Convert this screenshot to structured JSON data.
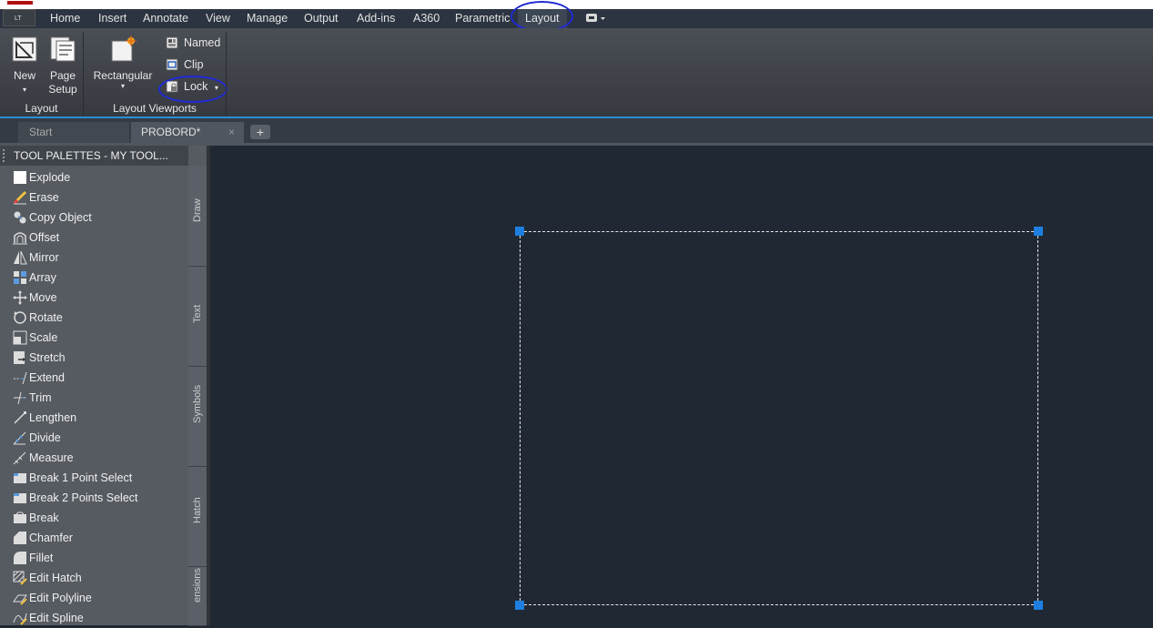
{
  "app": {
    "badge": "LT",
    "accent": "#1e7fe0",
    "annotation_color": "#1f2ad6"
  },
  "ribbon_tabs": [
    "Home",
    "Insert",
    "Annotate",
    "View",
    "Manage",
    "Output",
    "Add-ins",
    "A360",
    "Parametric",
    "Layout"
  ],
  "active_ribbon_tab": "Layout",
  "ribbon": {
    "layout_panel": {
      "label": "Layout",
      "new_label": "New",
      "page_setup_label": "Page Setup"
    },
    "viewports_panel": {
      "label": "Layout Viewports",
      "rectangular_label": "Rectangular",
      "named_label": "Named",
      "clip_label": "Clip",
      "lock_label": "Lock"
    }
  },
  "doc_tabs": {
    "start": "Start",
    "active": "PROBORD*",
    "close_glyph": "×",
    "add_glyph": "+"
  },
  "palette": {
    "title": "TOOL PALETTES - MY TOOL...",
    "items": [
      {
        "label": "Explode",
        "icon": "explode-icon"
      },
      {
        "label": "Erase",
        "icon": "erase-icon"
      },
      {
        "label": "Copy Object",
        "icon": "copy-icon"
      },
      {
        "label": "Offset",
        "icon": "offset-icon"
      },
      {
        "label": "Mirror",
        "icon": "mirror-icon"
      },
      {
        "label": "Array",
        "icon": "array-icon"
      },
      {
        "label": "Move",
        "icon": "move-icon"
      },
      {
        "label": "Rotate",
        "icon": "rotate-icon"
      },
      {
        "label": "Scale",
        "icon": "scale-icon"
      },
      {
        "label": "Stretch",
        "icon": "stretch-icon"
      },
      {
        "label": "Extend",
        "icon": "extend-icon"
      },
      {
        "label": "Trim",
        "icon": "trim-icon"
      },
      {
        "label": "Lengthen",
        "icon": "lengthen-icon"
      },
      {
        "label": "Divide",
        "icon": "divide-icon"
      },
      {
        "label": "Measure",
        "icon": "measure-icon"
      },
      {
        "label": "Break 1 Point Select",
        "icon": "break-point-icon"
      },
      {
        "label": "Break 2 Points Select",
        "icon": "break-points-icon"
      },
      {
        "label": "Break",
        "icon": "break-icon"
      },
      {
        "label": "Chamfer",
        "icon": "chamfer-icon"
      },
      {
        "label": "Fillet",
        "icon": "fillet-icon"
      },
      {
        "label": "Edit Hatch",
        "icon": "edit-hatch-icon"
      },
      {
        "label": "Edit Polyline",
        "icon": "edit-polyline-icon"
      },
      {
        "label": "Edit Spline",
        "icon": "edit-spline-icon"
      }
    ],
    "side_tabs": [
      "Draw",
      "Text",
      "Symbols",
      "Hatch",
      "ensions"
    ]
  }
}
